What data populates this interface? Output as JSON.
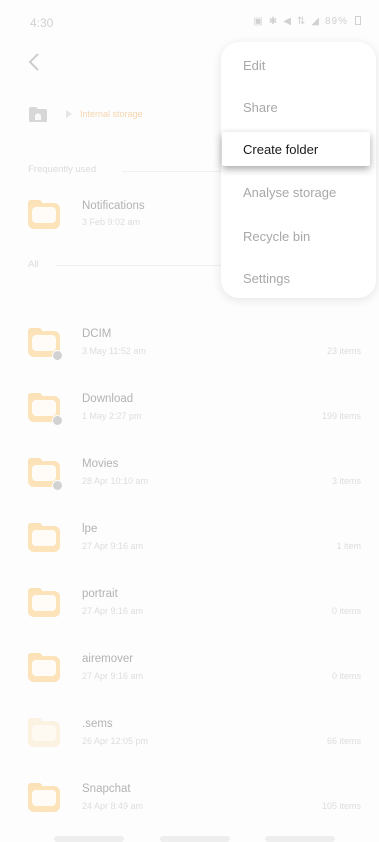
{
  "status_bar": {
    "time": "4:30",
    "battery": "89%",
    "icons": [
      "notification-icon",
      "settings-icon",
      "mute-icon",
      "network-icon",
      "signal-icon",
      "battery-icon"
    ]
  },
  "path": {
    "location": "Internal storage"
  },
  "sections": {
    "frequently_used": "Frequently used",
    "all": "All"
  },
  "frequent": [
    {
      "name": "Notifications",
      "date": "3 Feb 9:02 am"
    }
  ],
  "folders": [
    {
      "name": "DCIM",
      "date": "3 May 11:52 am",
      "count": "23 items",
      "badge": "camera"
    },
    {
      "name": "Download",
      "date": "1 May 2:27 pm",
      "count": "199 items",
      "badge": "download"
    },
    {
      "name": "Movies",
      "date": "28 Apr 10:10 am",
      "count": "3 items",
      "badge": "play"
    },
    {
      "name": "lpe",
      "date": "27 Apr 9:16 am",
      "count": "1 item",
      "badge": ""
    },
    {
      "name": "portrait",
      "date": "27 Apr 9:16 am",
      "count": "0 items",
      "badge": ""
    },
    {
      "name": "airemover",
      "date": "27 Apr 9:16 am",
      "count": "0 items",
      "badge": ""
    },
    {
      "name": ".sems",
      "date": "26 Apr 12:05 pm",
      "count": "66 items",
      "badge": ""
    },
    {
      "name": "Snapchat",
      "date": "24 Apr 8:49 am",
      "count": "105 items",
      "badge": ""
    }
  ],
  "menu": {
    "items": [
      "Edit",
      "Share",
      "Create folder",
      "Analyse storage",
      "Recycle bin",
      "Settings"
    ],
    "highlighted": "Create folder"
  },
  "colors": {
    "folder": "#f8c064",
    "accent": "#e6a24a"
  }
}
